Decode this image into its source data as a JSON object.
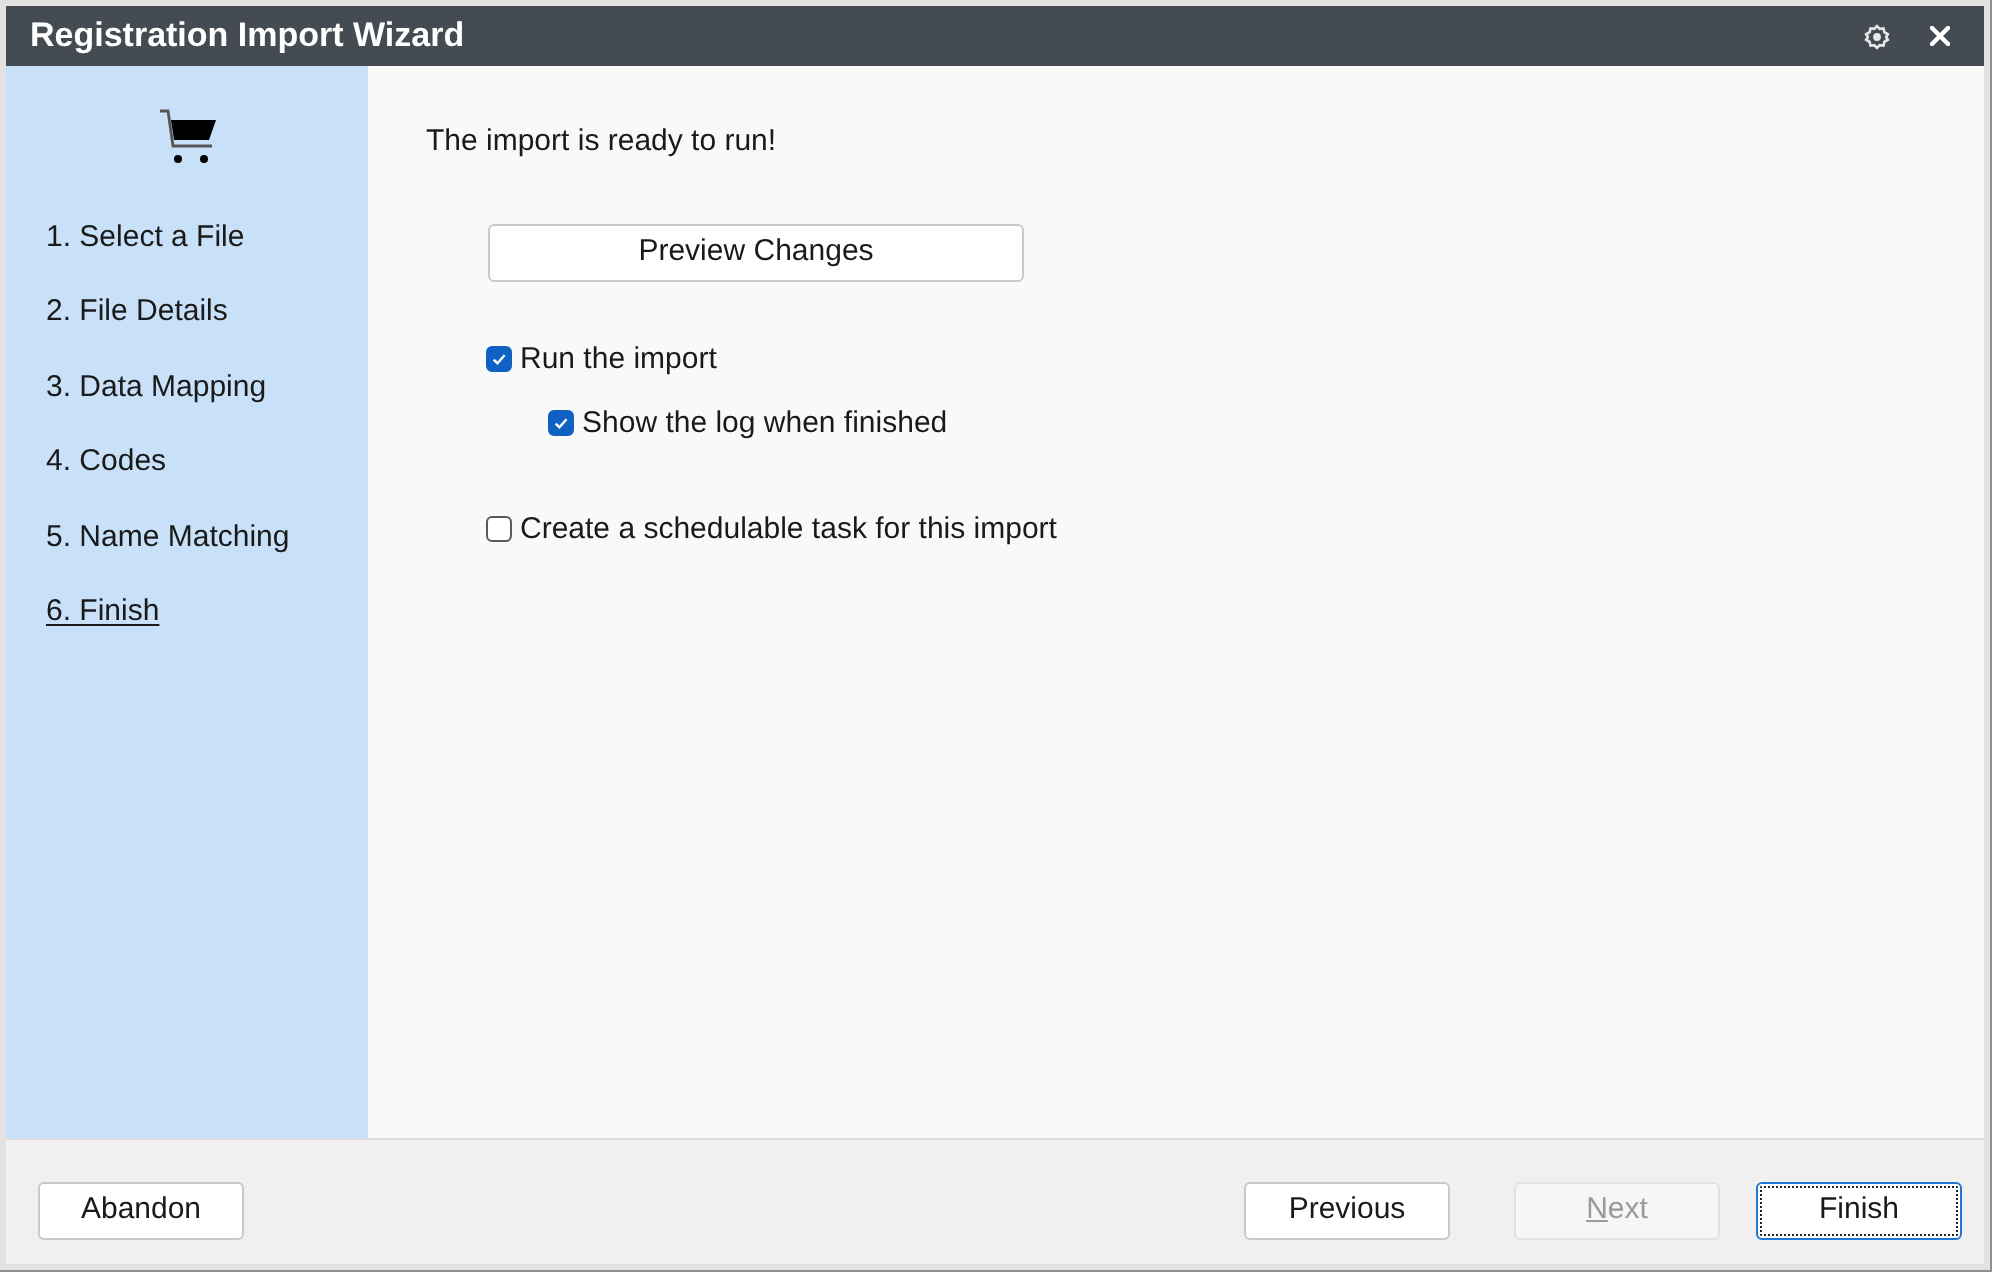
{
  "window": {
    "title": "Registration Import Wizard"
  },
  "sidebar": {
    "steps": [
      {
        "label": "1. Select a File",
        "selected": false
      },
      {
        "label": "2. File Details",
        "selected": false
      },
      {
        "label": "3. Data Mapping",
        "selected": false
      },
      {
        "label": "4. Codes",
        "selected": false
      },
      {
        "label": "5. Name Matching",
        "selected": false
      },
      {
        "label": "6. Finish",
        "selected": true
      }
    ]
  },
  "content": {
    "message": "The import is ready to run!",
    "preview_button": "Preview Changes",
    "options": [
      {
        "label": "Run the import",
        "checked": true,
        "children": [
          {
            "label": "Show the log when finished",
            "checked": true
          }
        ]
      },
      {
        "label": "Create a schedulable task for this import",
        "checked": false
      }
    ]
  },
  "footer": {
    "left_buttons": [
      {
        "label": "Abandon",
        "disabled": false,
        "focused": false,
        "mnemonic_underlined": false
      }
    ],
    "right_buttons": [
      {
        "label": "Previous",
        "disabled": false,
        "focused": false,
        "mnemonic_underlined": false
      },
      {
        "label": "Next",
        "disabled": true,
        "focused": false,
        "mnemonic_underlined": true
      },
      {
        "label": "Finish",
        "disabled": false,
        "focused": true,
        "mnemonic_underlined": false
      }
    ]
  }
}
